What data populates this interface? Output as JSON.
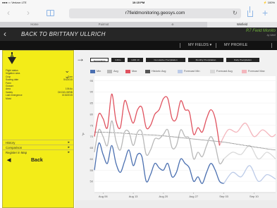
{
  "statusbar": {
    "carrier": "●●●○○ Verizon  LTE",
    "time": "10:15 PM",
    "battery": "⚡ 100%"
  },
  "browser": {
    "address": "r7fieldmonitoring.geosys.com",
    "tabs": [
      "Home",
      "Pairmot",
      "⊕",
      "Winfield"
    ]
  },
  "header": {
    "back_label": "BACK TO BRITTANY ULLRICH",
    "brand_line1": "R7 Field Monito",
    "brand_line2": "by Winfi"
  },
  "subheader": {
    "my_fields": "MY FIELDS ▾",
    "my_profile": "MY PROFILE"
  },
  "sidebar": {
    "fields": [
      {
        "label": "Flight status",
        "value": ""
      },
      {
        "label": "Irrigation area",
        "value": ""
      },
      {
        "label": "Crop",
        "value": "Corn"
      },
      {
        "label": "Sowing date",
        "value": "5/4/2015"
      },
      {
        "label": "Farm",
        "value": ""
      },
      {
        "label": "Grower",
        "value": ""
      },
      {
        "label": "Area",
        "value": "106 Ac"
      },
      {
        "label": "Variety",
        "value": "DKC63-33RIB"
      },
      {
        "label": "Last emergence",
        "value": "6/15/2015"
      },
      {
        "label": "Moist",
        "value": ""
      }
    ],
    "links": [
      "History",
      "Comparison",
      "Register in Map"
    ],
    "back_label": "Back"
  },
  "chart_tabs": [
    "Temperature",
    "GDUs",
    "GDD 10",
    "Cumulative Precipitation",
    "Monthly Precipitation",
    "Daily Precipitation"
  ],
  "colors": {
    "min": "#4a6fb0",
    "avg": "#b8b8b8",
    "max": "#e0525f",
    "historic_avg": "#444444",
    "forecast_min": "#bccbe8",
    "forecast_avg": "#d9d9d9",
    "forecast_max": "#f4b6bd"
  },
  "chart_data": {
    "type": "line",
    "title": "",
    "xlabel": "",
    "ylabel": "°F",
    "ylim": [
      45,
      97
    ],
    "yticks": [
      50,
      55,
      60,
      65,
      70,
      75,
      80,
      85,
      90,
      95
    ],
    "x_ticks": [
      "Aug 06",
      "Aug 13",
      "Aug 20",
      "Aug 27",
      "Sep 03",
      "Sep 10"
    ],
    "x_range_days": [
      0,
      42
    ],
    "series": [
      {
        "name": "Min",
        "style": "solid",
        "points": [
          [
            0,
            55
          ],
          [
            1,
            67
          ],
          [
            2,
            62
          ],
          [
            3,
            58
          ],
          [
            4,
            66
          ],
          [
            5,
            58
          ],
          [
            6,
            54
          ],
          [
            7,
            59
          ],
          [
            8,
            64
          ],
          [
            9,
            57
          ],
          [
            10,
            62
          ],
          [
            11,
            61
          ],
          [
            12,
            50
          ],
          [
            13,
            53
          ],
          [
            14,
            58
          ],
          [
            15,
            56
          ],
          [
            16,
            55
          ],
          [
            17,
            58
          ],
          [
            18,
            52
          ],
          [
            19,
            54
          ],
          [
            20,
            60
          ],
          [
            21,
            58
          ],
          [
            22,
            56
          ],
          [
            23,
            50
          ],
          [
            24,
            52
          ],
          [
            25,
            49
          ],
          [
            26,
            54
          ],
          [
            27,
            58
          ],
          [
            28,
            55
          ],
          [
            29,
            50
          ],
          [
            30,
            49
          ]
        ]
      },
      {
        "name": "Avg",
        "style": "solid",
        "points": [
          [
            0,
            63
          ],
          [
            1,
            73
          ],
          [
            2,
            70
          ],
          [
            3,
            66
          ],
          [
            4,
            77
          ],
          [
            5,
            68
          ],
          [
            6,
            64
          ],
          [
            7,
            72
          ],
          [
            8,
            72
          ],
          [
            9,
            66
          ],
          [
            10,
            72
          ],
          [
            11,
            72
          ],
          [
            12,
            62
          ],
          [
            13,
            64
          ],
          [
            14,
            69
          ],
          [
            15,
            69
          ],
          [
            16,
            71
          ],
          [
            17,
            73
          ],
          [
            18,
            65
          ],
          [
            19,
            66
          ],
          [
            20,
            73
          ],
          [
            21,
            70
          ],
          [
            22,
            69
          ],
          [
            23,
            60
          ],
          [
            24,
            63
          ],
          [
            25,
            61
          ],
          [
            26,
            66
          ],
          [
            27,
            70
          ],
          [
            28,
            66
          ],
          [
            29,
            58
          ],
          [
            30,
            60
          ]
        ]
      },
      {
        "name": "Max",
        "style": "solid",
        "points": [
          [
            0,
            70
          ],
          [
            1,
            80
          ],
          [
            2,
            78
          ],
          [
            3,
            74
          ],
          [
            4,
            89
          ],
          [
            5,
            77
          ],
          [
            6,
            74
          ],
          [
            7,
            86
          ],
          [
            8,
            81
          ],
          [
            9,
            76
          ],
          [
            10,
            82
          ],
          [
            11,
            83
          ],
          [
            12,
            74
          ],
          [
            13,
            75
          ],
          [
            14,
            80
          ],
          [
            15,
            82
          ],
          [
            16,
            87
          ],
          [
            17,
            87
          ],
          [
            18,
            78
          ],
          [
            19,
            78
          ],
          [
            20,
            86
          ],
          [
            21,
            82
          ],
          [
            22,
            81
          ],
          [
            23,
            71
          ],
          [
            24,
            74
          ],
          [
            25,
            72
          ],
          [
            26,
            78
          ],
          [
            27,
            82
          ],
          [
            28,
            78
          ],
          [
            29,
            66
          ]
        ]
      },
      {
        "name": "Historic Avg",
        "style": "dotted",
        "points": [
          [
            0,
            72
          ],
          [
            5,
            71.7
          ],
          [
            10,
            71
          ],
          [
            15,
            70.5
          ],
          [
            20,
            69.5
          ],
          [
            25,
            68.5
          ],
          [
            30,
            67.5
          ],
          [
            35,
            66
          ],
          [
            40,
            64.5
          ],
          [
            42,
            64
          ]
        ]
      },
      {
        "name": "Forecast Min",
        "style": "solid",
        "points": [
          [
            30,
            49
          ],
          [
            32,
            54
          ],
          [
            34,
            52
          ],
          [
            36,
            57
          ],
          [
            38,
            50
          ],
          [
            40,
            53
          ],
          [
            42,
            51
          ]
        ]
      },
      {
        "name": "Forecast Avg",
        "style": "solid",
        "points": [
          [
            30,
            60
          ],
          [
            32,
            63
          ],
          [
            34,
            62
          ],
          [
            36,
            66
          ],
          [
            38,
            60
          ],
          [
            40,
            63
          ],
          [
            42,
            60
          ]
        ]
      },
      {
        "name": "Forecast Max",
        "style": "solid",
        "points": [
          [
            29,
            66
          ],
          [
            31,
            73
          ],
          [
            33,
            72
          ],
          [
            35,
            76
          ],
          [
            37,
            70
          ],
          [
            39,
            73
          ],
          [
            41,
            70
          ],
          [
            42,
            71
          ]
        ]
      }
    ]
  }
}
